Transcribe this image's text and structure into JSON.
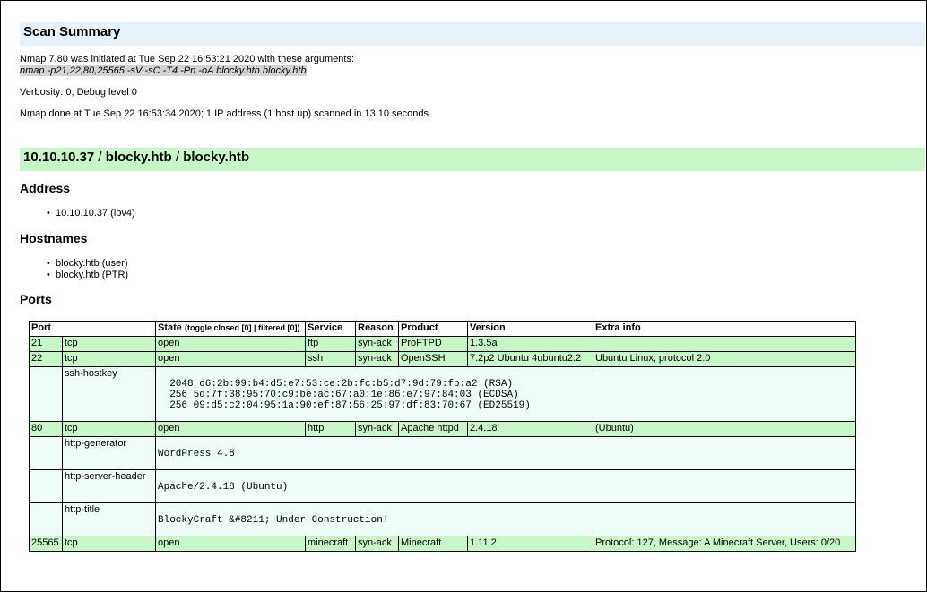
{
  "summary": {
    "title": "Scan Summary",
    "initiated": "Nmap 7.80 was initiated at Tue Sep 22 16:53:21 2020 with these arguments:",
    "command": "nmap -p21,22,80,25565 -sV -sC -T4 -Pn -oA blocky.htb blocky.htb",
    "verbosity": "Verbosity: 0; Debug level 0",
    "done": "Nmap done at Tue Sep 22 16:53:34 2020; 1 IP address (1 host up) scanned in 13.10 seconds"
  },
  "host": {
    "ip": "10.10.10.37",
    "sep": " / ",
    "name1": "blocky.htb",
    "name2": "blocky.htb",
    "address_heading": "Address",
    "address": "10.10.10.37 (ipv4)",
    "hostnames_heading": "Hostnames",
    "hostnames": [
      "blocky.htb (user)",
      "blocky.htb (PTR)"
    ],
    "ports_heading": "Ports"
  },
  "ports_table": {
    "headers": {
      "port": "Port",
      "state": "State",
      "toggle_closed": "toggle closed [0]",
      "toggle_sep": " | ",
      "filtered": "filtered [0]",
      "service": "Service",
      "reason": "Reason",
      "product": "Product",
      "version": "Version",
      "extra": "Extra info"
    },
    "rows": [
      {
        "port": "21",
        "proto": "tcp",
        "state": "open",
        "service": "ftp",
        "reason": "syn-ack",
        "product": "ProFTPD",
        "version": "1.3.5a",
        "extra": ""
      },
      {
        "port": "22",
        "proto": "tcp",
        "state": "open",
        "service": "ssh",
        "reason": "syn-ack",
        "product": "OpenSSH",
        "version": "7.2p2 Ubuntu 4ubuntu2.2",
        "extra": "Ubuntu Linux; protocol 2.0"
      },
      {
        "port": "80",
        "proto": "tcp",
        "state": "open",
        "service": "http",
        "reason": "syn-ack",
        "product": "Apache httpd",
        "version": "2.4.18",
        "extra": "(Ubuntu)"
      },
      {
        "port": "25565",
        "proto": "tcp",
        "state": "open",
        "service": "minecraft",
        "reason": "syn-ack",
        "product": "Minecraft",
        "version": "1.11.2",
        "extra": "Protocol: 127, Message: A Minecraft Server, Users: 0/20"
      }
    ],
    "scripts": {
      "ssh_hostkey": {
        "name": "ssh-hostkey",
        "output": "\n  2048 d6:2b:99:b4:d5:e7:53:ce:2b:fc:b5:d7:9d:79:fb:a2 (RSA)\n  256 5d:7f:38:95:70:c9:be:ac:67:a0:1e:86:e7:97:84:03 (ECDSA)\n  256 09:d5:c2:04:95:1a:90:ef:87:56:25:97:df:83:70:67 (ED25519)\n"
      },
      "http_generator": {
        "name": "http-generator",
        "output": "WordPress 4.8"
      },
      "http_server_header": {
        "name": "http-server-header",
        "output": "Apache/2.4.18 (Ubuntu)"
      },
      "http_title": {
        "name": "http-title",
        "output": "BlockyCraft &#8211; Under Construction!"
      }
    }
  }
}
